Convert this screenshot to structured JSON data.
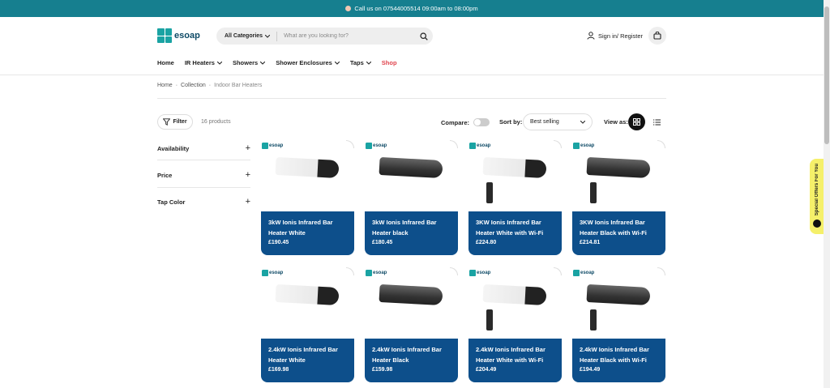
{
  "announcement": {
    "text": "Call us on 07544005514 09:00am to 08:00pm"
  },
  "brand": {
    "name": "esoap"
  },
  "search": {
    "category": "All Categories",
    "placeholder": "What are you looking for?"
  },
  "account": {
    "label": "Sign in/ Register"
  },
  "nav": [
    {
      "label": "Home",
      "dropdown": false
    },
    {
      "label": "IR Heaters",
      "dropdown": true
    },
    {
      "label": "Showers",
      "dropdown": true
    },
    {
      "label": "Shower Enclosures",
      "dropdown": true
    },
    {
      "label": "Taps",
      "dropdown": true
    },
    {
      "label": "Shop",
      "dropdown": false,
      "highlight": "#e0434c"
    }
  ],
  "breadcrumb": [
    "Home",
    "Collection",
    "Indoor Bar Heaters"
  ],
  "toolbar": {
    "filter_label": "Filter",
    "count": "16 products",
    "compare_label": "Compare:",
    "sort_label": "Sort by:",
    "sort_value": "Best selling",
    "view_label": "View as:"
  },
  "facets": [
    "Availability",
    "Price",
    "Tap Color"
  ],
  "offers_tab": "Special Offers For You",
  "products": [
    {
      "title": "3kW Ionis Infrared Bar Heater White",
      "price": "£190.45",
      "color": "white",
      "remote": false
    },
    {
      "title": "3kW Ionis Infrared Bar Heater black",
      "price": "£180.45",
      "color": "black",
      "remote": false
    },
    {
      "title": "3KW Ionis Infrared Bar Heater White with Wi-Fi",
      "price": "£224.80",
      "color": "white",
      "remote": true
    },
    {
      "title": "3KW Ionis Infrared Bar Heater Black with Wi-Fi",
      "price": "£214.81",
      "color": "black",
      "remote": true
    },
    {
      "title": "2.4kW Ionis Infrared Bar Heater White",
      "price": "£169.98",
      "color": "white",
      "remote": false
    },
    {
      "title": "2.4kW Ionis Infrared Bar Heater Black",
      "price": "£159.98",
      "color": "black",
      "remote": false
    },
    {
      "title": "2.4kW Ionis Infrared Bar Heater White with Wi-Fi",
      "price": "£204.49",
      "color": "white",
      "remote": true
    },
    {
      "title": "2.4kW Ionis Infrared Bar Heater Black with Wi-Fi",
      "price": "£194.49",
      "color": "black",
      "remote": true
    }
  ],
  "colors": {
    "announcement_bg": "#167f8f",
    "card_info_bg": "#0d4f8b",
    "shop_link": "#e0434c",
    "offers_bg": "#f5f06a"
  }
}
